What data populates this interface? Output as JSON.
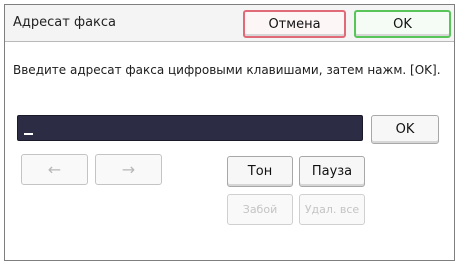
{
  "dialog": {
    "title": "Адресат факса",
    "cancel_label": "Отмена",
    "ok_label": "OK"
  },
  "instruction": "Введите адресат факса цифровыми клавишами, затем нажм. [OK].",
  "entry": {
    "value": "",
    "ok_label": "OK"
  },
  "cursor_buttons": {
    "left_label": "←",
    "right_label": "→"
  },
  "actions": {
    "tone_label": "Тон",
    "pause_label": "Пауза",
    "backspace_label": "Забой",
    "clear_all_label": "Удал. все"
  },
  "colors": {
    "cancel_border": "#e06a78",
    "ok_border": "#58c558",
    "input_background": "#2c2c45"
  }
}
